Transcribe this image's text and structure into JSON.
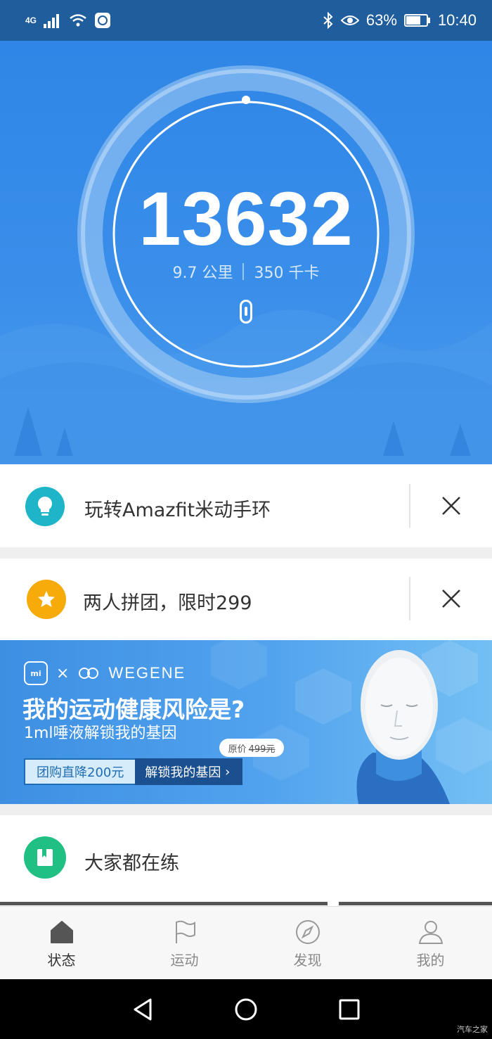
{
  "status_bar": {
    "network": "4G",
    "battery": "63%",
    "time": "10:40",
    "icons": [
      "signal-icon",
      "wifi-icon",
      "mi-app-icon",
      "bluetooth-icon",
      "eye-icon",
      "battery-icon"
    ]
  },
  "activity": {
    "steps": "13632",
    "distance": "9.7 公里",
    "calories": "350 千卡",
    "device_icon": "band-icon",
    "progress": 1.0
  },
  "cards": [
    {
      "label": "玩转Amazfit米动手环",
      "icon": "lightbulb-icon",
      "color": "#1fb5c9"
    },
    {
      "label": "两人拼团，限时299",
      "icon": "star-icon",
      "color": "#f7ab0a"
    }
  ],
  "banner": {
    "brand_mi": "mi",
    "brand_x": "×",
    "brand_partner": "WEGENE",
    "headline": "我的运动健康风险是?",
    "subtitle": "1ml唾液解锁我的基因",
    "original_price_label": "原价",
    "original_price": "499元",
    "cta_primary": "团购直降200元",
    "cta_secondary": "解锁我的基因",
    "cta_arrow": "›"
  },
  "section": {
    "label": "大家都在练",
    "icon": "bookmark-icon",
    "color": "#20c084"
  },
  "tabs": [
    {
      "label": "状态",
      "icon": "home-icon",
      "active": true
    },
    {
      "label": "运动",
      "icon": "flag-icon",
      "active": false
    },
    {
      "label": "发现",
      "icon": "compass-icon",
      "active": false
    },
    {
      "label": "我的",
      "icon": "person-icon",
      "active": false
    }
  ],
  "watermark": "汽车之家"
}
